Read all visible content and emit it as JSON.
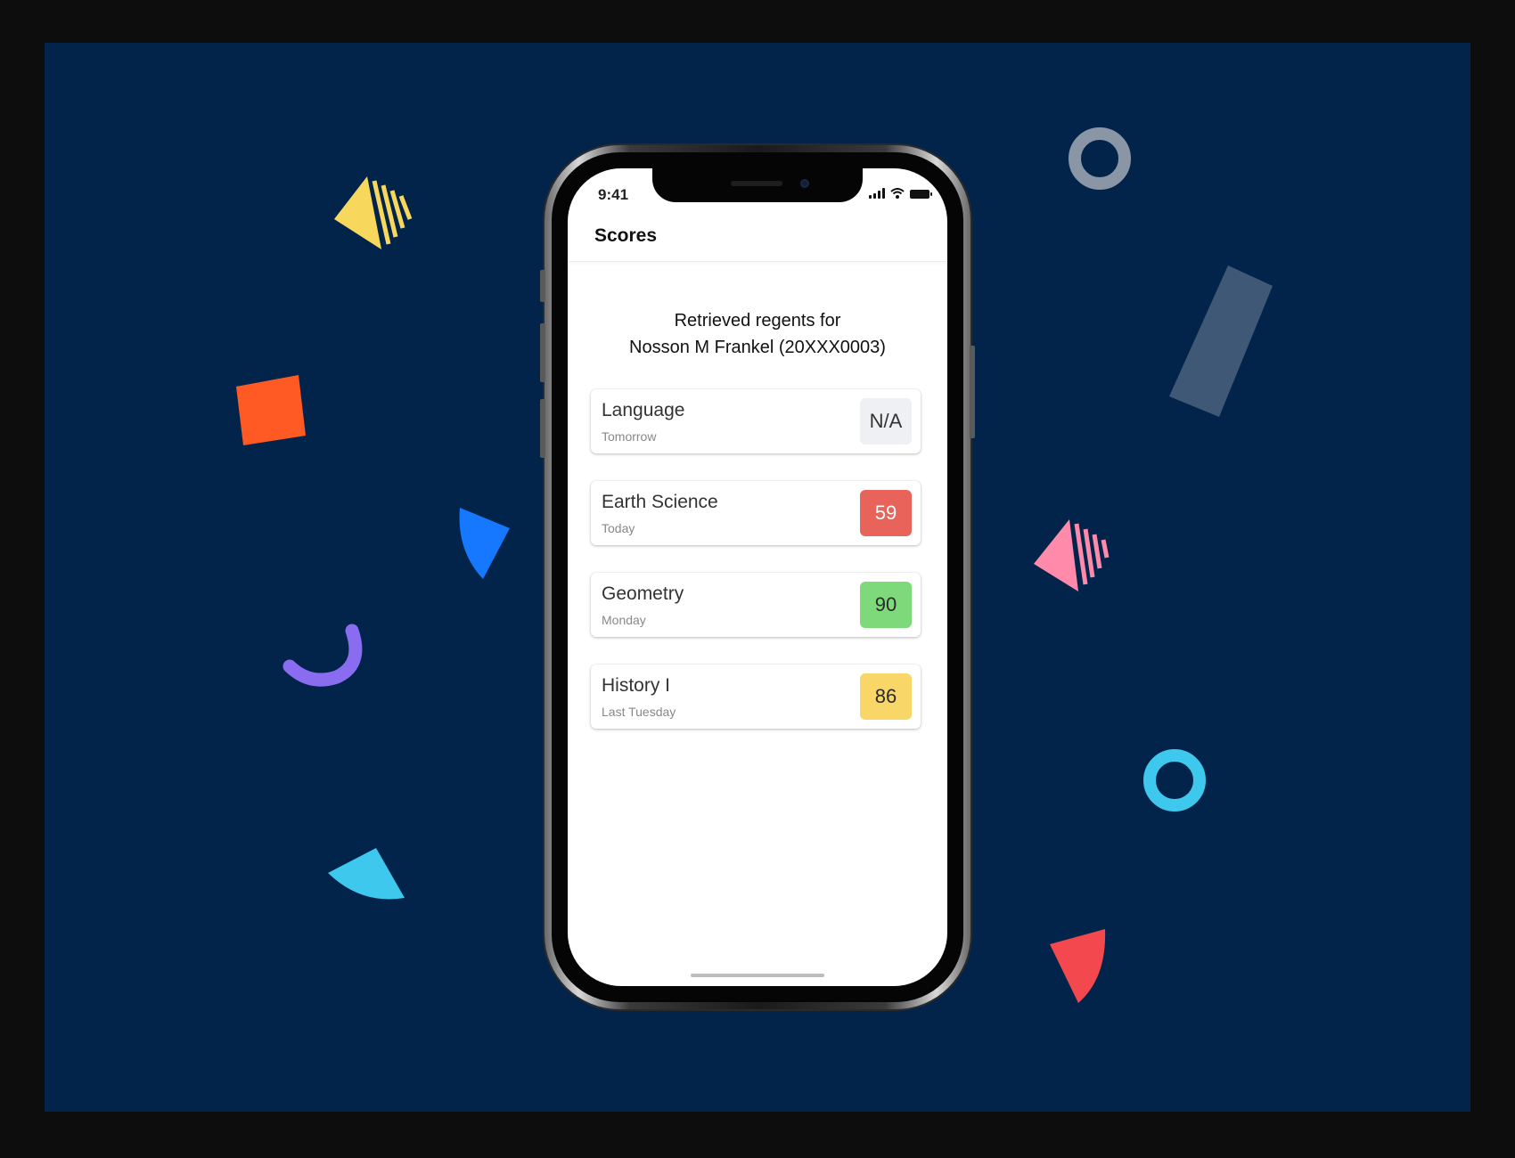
{
  "status_bar": {
    "time": "9:41"
  },
  "header": {
    "title": "Scores"
  },
  "summary": {
    "line1": "Retrieved regents for",
    "line2": "Nosson M Frankel (20XXX0003)"
  },
  "scores": [
    {
      "subject": "Language",
      "when": "Tomorrow",
      "score": "N/A",
      "badge_bg": "#eef0f3",
      "badge_fg": "#333333"
    },
    {
      "subject": "Earth Science",
      "when": "Today",
      "score": "59",
      "badge_bg": "#e8645a",
      "badge_fg": "#ffffff"
    },
    {
      "subject": "Geometry",
      "when": "Monday",
      "score": "90",
      "badge_bg": "#7ed97a",
      "badge_fg": "#2a2a2a"
    },
    {
      "subject": "History I",
      "when": "Last Tuesday",
      "score": "86",
      "badge_bg": "#f8d768",
      "badge_fg": "#2a2a2a"
    }
  ],
  "colors": {
    "background": "#03244a",
    "frame": "#0d0d0d"
  },
  "icons": {
    "signal": "signal-icon",
    "wifi": "wifi-icon",
    "battery": "battery-icon"
  }
}
